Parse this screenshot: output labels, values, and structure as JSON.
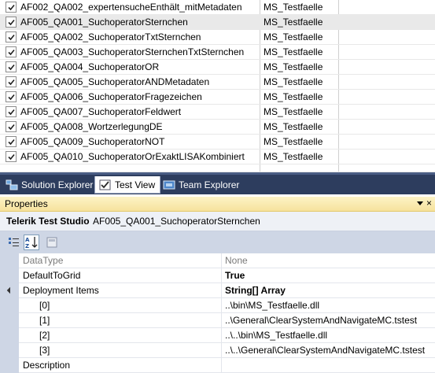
{
  "test_list": {
    "rows": [
      {
        "name": "AF002_QA002_expertensucheEnthält_mitMetadaten",
        "project": "MS_Testfaelle",
        "checked": true,
        "selected": false
      },
      {
        "name": "AF005_QA001_SuchoperatorSternchen",
        "project": "MS_Testfaelle",
        "checked": true,
        "selected": true
      },
      {
        "name": "AF005_QA002_SuchoperatorTxtSternchen",
        "project": "MS_Testfaelle",
        "checked": true,
        "selected": false
      },
      {
        "name": "AF005_QA003_SuchoperatorSternchenTxtSternchen",
        "project": "MS_Testfaelle",
        "checked": true,
        "selected": false
      },
      {
        "name": "AF005_QA004_SuchoperatorOR",
        "project": "MS_Testfaelle",
        "checked": true,
        "selected": false
      },
      {
        "name": "AF005_QA005_SuchoperatorANDMetadaten",
        "project": "MS_Testfaelle",
        "checked": true,
        "selected": false
      },
      {
        "name": "AF005_QA006_SuchoperatorFragezeichen",
        "project": "MS_Testfaelle",
        "checked": true,
        "selected": false
      },
      {
        "name": "AF005_QA007_SuchoperatorFeldwert",
        "project": "MS_Testfaelle",
        "checked": true,
        "selected": false
      },
      {
        "name": "AF005_QA008_WortzerlegungDE",
        "project": "MS_Testfaelle",
        "checked": true,
        "selected": false
      },
      {
        "name": "AF005_QA009_SuchoperatorNOT",
        "project": "MS_Testfaelle",
        "checked": true,
        "selected": false
      },
      {
        "name": "AF005_QA010_SuchoperatorOrExaktLISAKombiniert",
        "project": "MS_Testfaelle",
        "checked": true,
        "selected": false
      }
    ]
  },
  "tabs": [
    {
      "label": "Solution Explorer",
      "icon": "solution-explorer-icon",
      "active": false
    },
    {
      "label": "Test View",
      "icon": "test-view-icon",
      "active": true
    },
    {
      "label": "Team Explorer",
      "icon": "team-explorer-icon",
      "active": false
    }
  ],
  "properties": {
    "title": "Properties",
    "close_glyph": "×",
    "object_type": "Telerik Test Studio",
    "object_name": "AF005_QA001_SuchoperatorSternchen",
    "rows": [
      {
        "name": "DataType",
        "value": "None",
        "dim": true,
        "bold": false
      },
      {
        "name": "DefaultToGrid",
        "value": "True",
        "dim": false,
        "bold": true
      },
      {
        "name": "Deployment Items",
        "value": "String[] Array",
        "dim": false,
        "bold": true
      },
      {
        "name": "[0]",
        "value": "..\\bin\\MS_Testfaelle.dll",
        "dim": false,
        "bold": false
      },
      {
        "name": "[1]",
        "value": "..\\General\\ClearSystemAndNavigateMC.tstest",
        "dim": false,
        "bold": false
      },
      {
        "name": "[2]",
        "value": "..\\..\\bin\\MS_Testfaelle.dll",
        "dim": false,
        "bold": false
      },
      {
        "name": "[3]",
        "value": "..\\..\\General\\ClearSystemAndNavigateMC.tstest",
        "dim": false,
        "bold": false
      },
      {
        "name": "Description",
        "value": "",
        "dim": false,
        "bold": false
      }
    ]
  },
  "colors": {
    "tab_strip": "#2d3d5e",
    "props_header": "#f6e29d",
    "panel_bg": "#ced6e5"
  }
}
